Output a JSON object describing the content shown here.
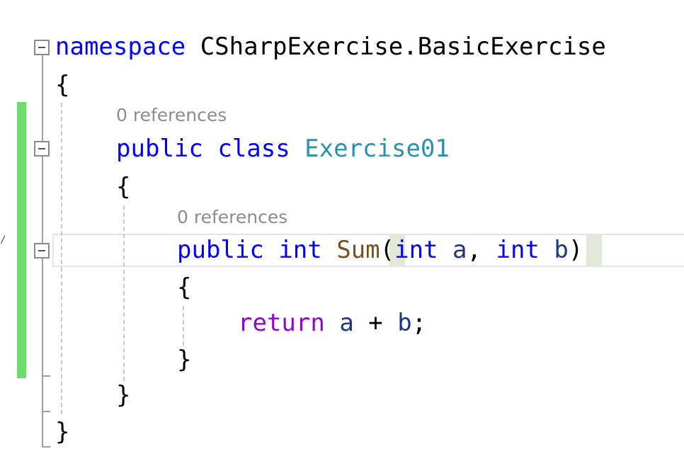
{
  "editor": {
    "colors": {
      "keyword": "#0000ff",
      "control": "#8f08c4",
      "type": "#2b91af",
      "method": "#74531f",
      "param": "#1f377f",
      "plain": "#000000",
      "hint": "#8c8c8c",
      "change_bar": "#6fdb6f"
    },
    "lines": [
      {
        "tokens": [
          {
            "t": "namespace",
            "k": "keyword"
          },
          {
            "t": " CSharpExercise.BasicExercise",
            "k": "plain"
          }
        ]
      },
      {
        "tokens": [
          {
            "t": "{",
            "k": "plain"
          }
        ]
      },
      {
        "tokens": [
          {
            "t": "public",
            "k": "keyword"
          },
          {
            "t": " ",
            "k": "plain"
          },
          {
            "t": "class",
            "k": "keyword"
          },
          {
            "t": " ",
            "k": "plain"
          },
          {
            "t": "Exercise01",
            "k": "type"
          }
        ]
      },
      {
        "tokens": [
          {
            "t": "{",
            "k": "plain"
          }
        ]
      },
      {
        "tokens": [
          {
            "t": "public",
            "k": "keyword"
          },
          {
            "t": " ",
            "k": "plain"
          },
          {
            "t": "int",
            "k": "keyword"
          },
          {
            "t": " ",
            "k": "plain"
          },
          {
            "t": "Sum",
            "k": "method"
          },
          {
            "t": "(",
            "k": "plain"
          },
          {
            "t": "int",
            "k": "keyword"
          },
          {
            "t": " ",
            "k": "plain"
          },
          {
            "t": "a",
            "k": "param"
          },
          {
            "t": ", ",
            "k": "plain"
          },
          {
            "t": "int",
            "k": "keyword"
          },
          {
            "t": " ",
            "k": "plain"
          },
          {
            "t": "b",
            "k": "param"
          },
          {
            "t": ")",
            "k": "plain"
          }
        ]
      },
      {
        "tokens": [
          {
            "t": "{",
            "k": "plain"
          }
        ]
      },
      {
        "tokens": [
          {
            "t": "return",
            "k": "control"
          },
          {
            "t": " ",
            "k": "plain"
          },
          {
            "t": "a",
            "k": "param"
          },
          {
            "t": " + ",
            "k": "plain"
          },
          {
            "t": "b",
            "k": "param"
          },
          {
            "t": ";",
            "k": "plain"
          }
        ]
      },
      {
        "tokens": [
          {
            "t": "}",
            "k": "plain"
          }
        ]
      },
      {
        "tokens": [
          {
            "t": "}",
            "k": "plain"
          }
        ]
      },
      {
        "tokens": [
          {
            "t": "}",
            "k": "plain"
          }
        ]
      }
    ],
    "hints": [
      {
        "label": "0 references"
      },
      {
        "label": "0 references"
      }
    ]
  }
}
